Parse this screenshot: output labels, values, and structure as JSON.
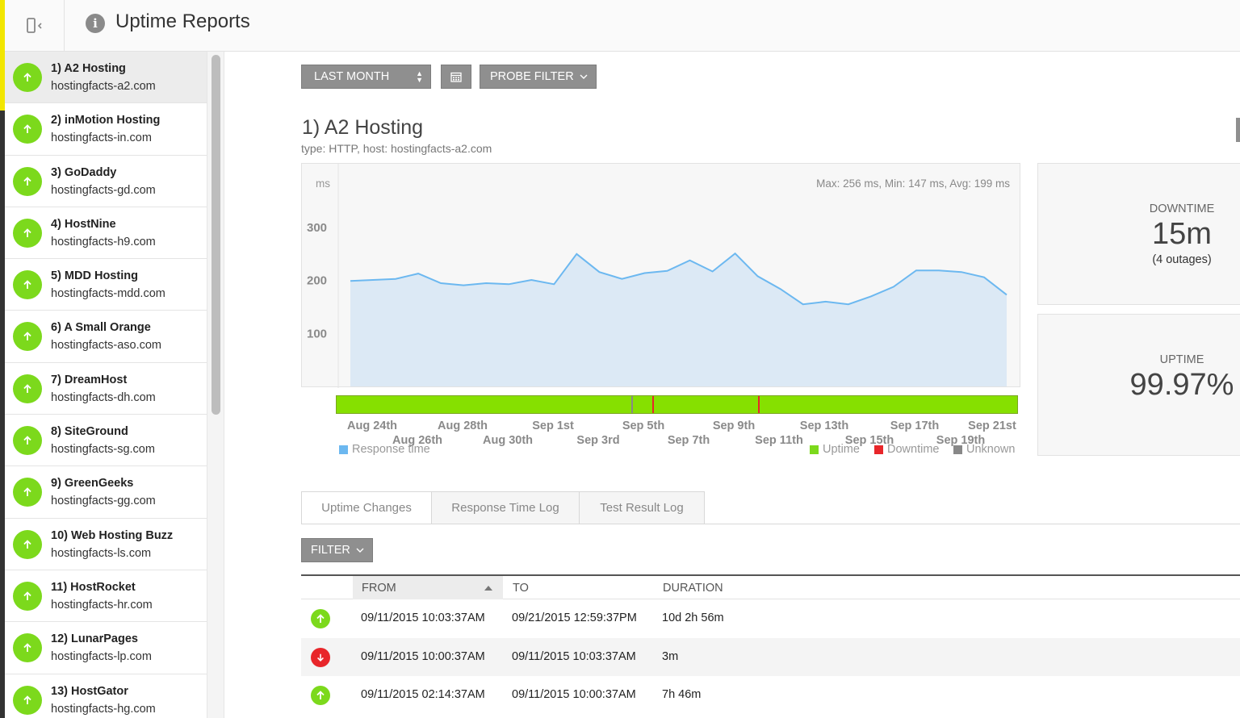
{
  "header": {
    "title": "Uptime Reports",
    "toggle_icon": "sidebar-collapse-icon",
    "info_icon": "i"
  },
  "sidebar": {
    "items": [
      {
        "name": "1) A2 Hosting",
        "domain": "hostingfacts-a2.com",
        "status": "up",
        "selected": true
      },
      {
        "name": "2) inMotion Hosting",
        "domain": "hostingfacts-in.com",
        "status": "up"
      },
      {
        "name": "3) GoDaddy",
        "domain": "hostingfacts-gd.com",
        "status": "up"
      },
      {
        "name": "4) HostNine",
        "domain": "hostingfacts-h9.com",
        "status": "up"
      },
      {
        "name": "5) MDD Hosting",
        "domain": "hostingfacts-mdd.com",
        "status": "up"
      },
      {
        "name": "6) A Small Orange",
        "domain": "hostingfacts-aso.com",
        "status": "up"
      },
      {
        "name": "7) DreamHost",
        "domain": "hostingfacts-dh.com",
        "status": "up"
      },
      {
        "name": "8) SiteGround",
        "domain": "hostingfacts-sg.com",
        "status": "up"
      },
      {
        "name": "9) GreenGeeks",
        "domain": "hostingfacts-gg.com",
        "status": "up"
      },
      {
        "name": "10) Web Hosting Buzz",
        "domain": "hostingfacts-ls.com",
        "status": "up"
      },
      {
        "name": "11) HostRocket",
        "domain": "hostingfacts-hr.com",
        "status": "up"
      },
      {
        "name": "12) LunarPages",
        "domain": "hostingfacts-lp.com",
        "status": "up"
      },
      {
        "name": "13) HostGator",
        "domain": "hostingfacts-hg.com",
        "status": "up"
      }
    ]
  },
  "toolbar": {
    "range_label": "LAST MONTH",
    "probe_filter_label": "PROBE FILTER"
  },
  "report": {
    "title": "1) A2 Hosting",
    "meta": "type: HTTP, host: hostingfacts-a2.com"
  },
  "chart_data": {
    "type": "area",
    "ylabel": "ms",
    "ylim": [
      0,
      400
    ],
    "y_ticks": [
      "300",
      "200",
      "100"
    ],
    "stats": "Max: 256 ms, Min: 147 ms, Avg: 199 ms",
    "x_ticks_row1": [
      "Aug 24th",
      "Aug 28th",
      "Sep 1st",
      "Sep 5th",
      "Sep 9th",
      "Sep 13th",
      "Sep 17th",
      "Sep 21st"
    ],
    "x_ticks_row2": [
      "Aug 26th",
      "Aug 30th",
      "Sep 3rd",
      "Sep 7th",
      "Sep 11th",
      "Sep 15th",
      "Sep 19th"
    ],
    "series": [
      {
        "name": "Response time",
        "color": "#6cb8f0",
        "x": [
          "Aug 23",
          "Aug 24",
          "Aug 25",
          "Aug 26",
          "Aug 27",
          "Aug 28",
          "Aug 29",
          "Aug 30",
          "Aug 31",
          "Sep 1",
          "Sep 2",
          "Sep 3",
          "Sep 4",
          "Sep 5",
          "Sep 6",
          "Sep 7",
          "Sep 8",
          "Sep 9",
          "Sep 10",
          "Sep 11",
          "Sep 12",
          "Sep 13",
          "Sep 14",
          "Sep 15",
          "Sep 16",
          "Sep 17",
          "Sep 18",
          "Sep 19",
          "Sep 20",
          "Sep 21"
        ],
        "values": [
          199,
          201,
          203,
          213,
          195,
          191,
          195,
          193,
          201,
          193,
          250,
          216,
          203,
          214,
          218,
          238,
          217,
          251,
          208,
          184,
          155,
          160,
          155,
          170,
          188,
          219,
          219,
          216,
          206,
          173
        ]
      }
    ],
    "status_bar": {
      "segments": [
        {
          "type": "uptime",
          "from": "Aug 23",
          "to": "Sep 21"
        }
      ],
      "marks": [
        {
          "type": "unknown",
          "at": "Sep 5"
        },
        {
          "type": "downtime",
          "at": "Sep 6"
        },
        {
          "type": "downtime",
          "at": "Sep 11"
        }
      ]
    },
    "legend": [
      {
        "name": "Response time",
        "color": "#6cb8f0",
        "position": "bottom-left"
      },
      {
        "name": "Uptime",
        "color": "#7cd91c",
        "position": "bottom-right"
      },
      {
        "name": "Downtime",
        "color": "#e8262a",
        "position": "bottom-right"
      },
      {
        "name": "Unknown",
        "color": "#888888",
        "position": "bottom-right"
      }
    ]
  },
  "stats": {
    "downtime_label": "DOWNTIME",
    "downtime_value": "15m",
    "downtime_outages": "(4 outages)",
    "uptime_label": "UPTIME",
    "uptime_value": "99.97%"
  },
  "tabs": [
    {
      "label": "Uptime Changes",
      "active": true
    },
    {
      "label": "Response Time Log"
    },
    {
      "label": "Test Result Log"
    }
  ],
  "filter_label": "FILTER",
  "log_table": {
    "columns": {
      "from": "FROM",
      "to": "TO",
      "duration": "DURATION"
    },
    "rows": [
      {
        "status": "up",
        "from": "09/11/2015 10:03:37AM",
        "to": "09/21/2015 12:59:37PM",
        "duration": "10d 2h 56m"
      },
      {
        "status": "down",
        "from": "09/11/2015 10:00:37AM",
        "to": "09/11/2015 10:03:37AM",
        "duration": "3m"
      },
      {
        "status": "up",
        "from": "09/11/2015 02:14:37AM",
        "to": "09/11/2015 10:00:37AM",
        "duration": "7h 46m"
      }
    ]
  },
  "colors": {
    "up": "#7cd91c",
    "down": "#e8262a",
    "button": "#8f8f8f",
    "chart_fill": "#dce9f5"
  }
}
